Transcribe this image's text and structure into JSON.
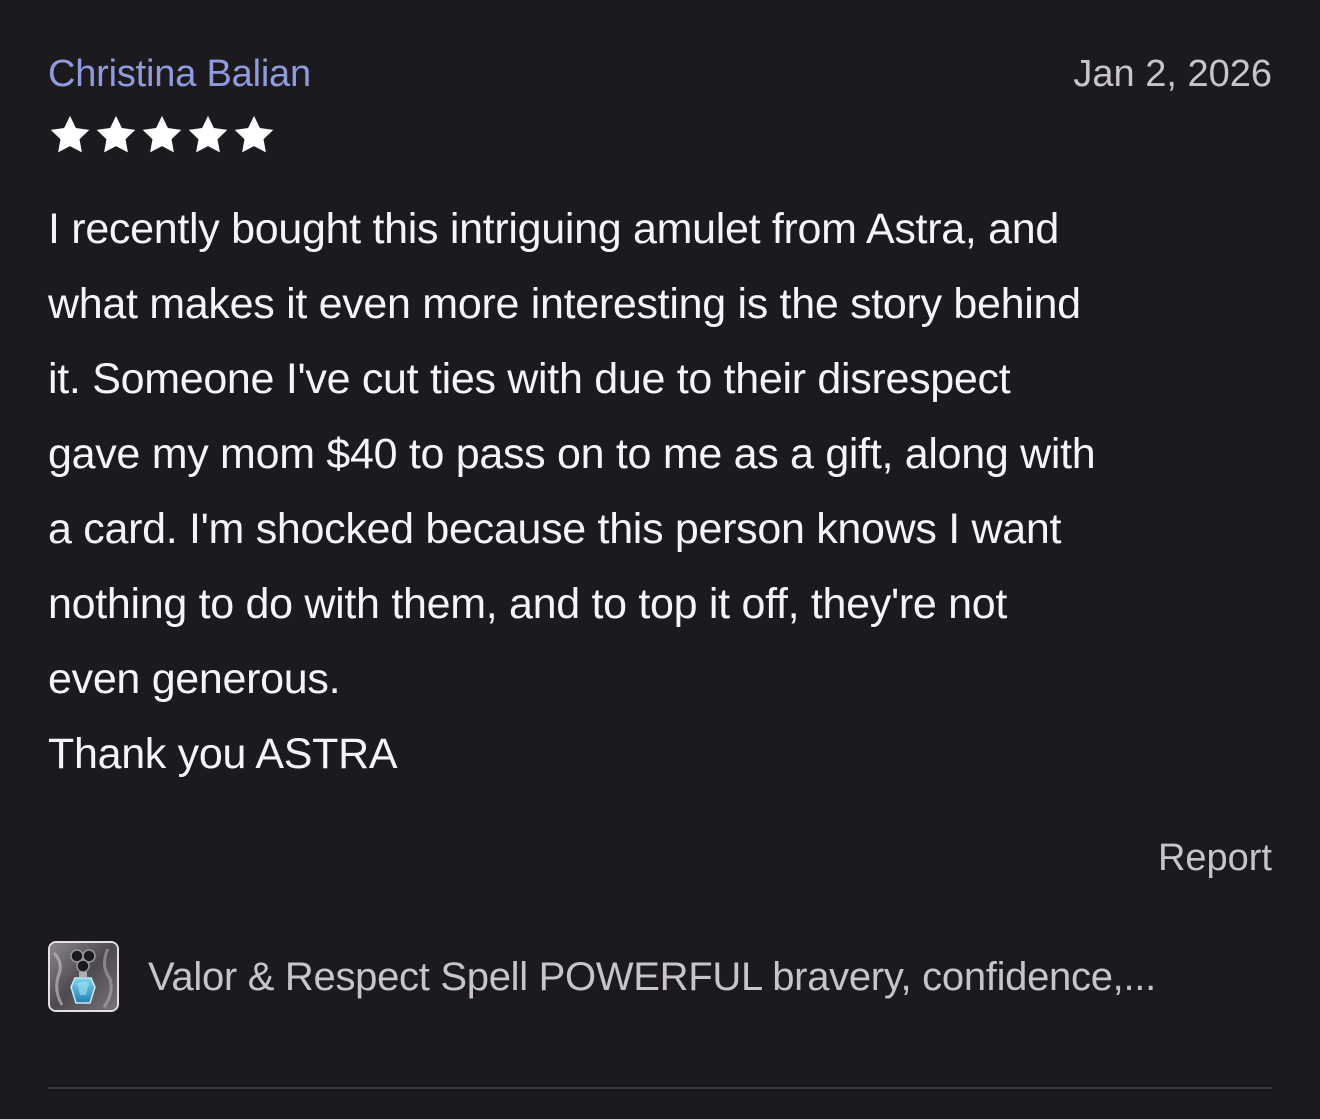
{
  "review": {
    "reviewer_name": "Christina Balian",
    "date": "Jan 2, 2026",
    "rating": 5,
    "rating_max": 5,
    "text": "I recently bought this intriguing amulet from Astra, and\nwhat makes it even more interesting is the story behind\nit. Someone I've cut ties with due to their disrespect\ngave my mom $40 to pass on to me as a gift, along with\na card. I'm shocked because this person knows I want\nnothing to do with them, and to top it off, they're not\neven generous.\nThank you ASTRA",
    "report_label": "Report"
  },
  "product": {
    "title": "Valor & Respect Spell POWERFUL bravery, confidence,...",
    "thumbnail_icon": "amulet-thumbnail-icon"
  },
  "colors": {
    "background": "#1c1a1f",
    "name_accent": "#8f9bdc",
    "muted_text": "#c8c5ca",
    "body_text": "#f6f4f7",
    "star": "#ffffff",
    "divider": "#3a383d"
  }
}
